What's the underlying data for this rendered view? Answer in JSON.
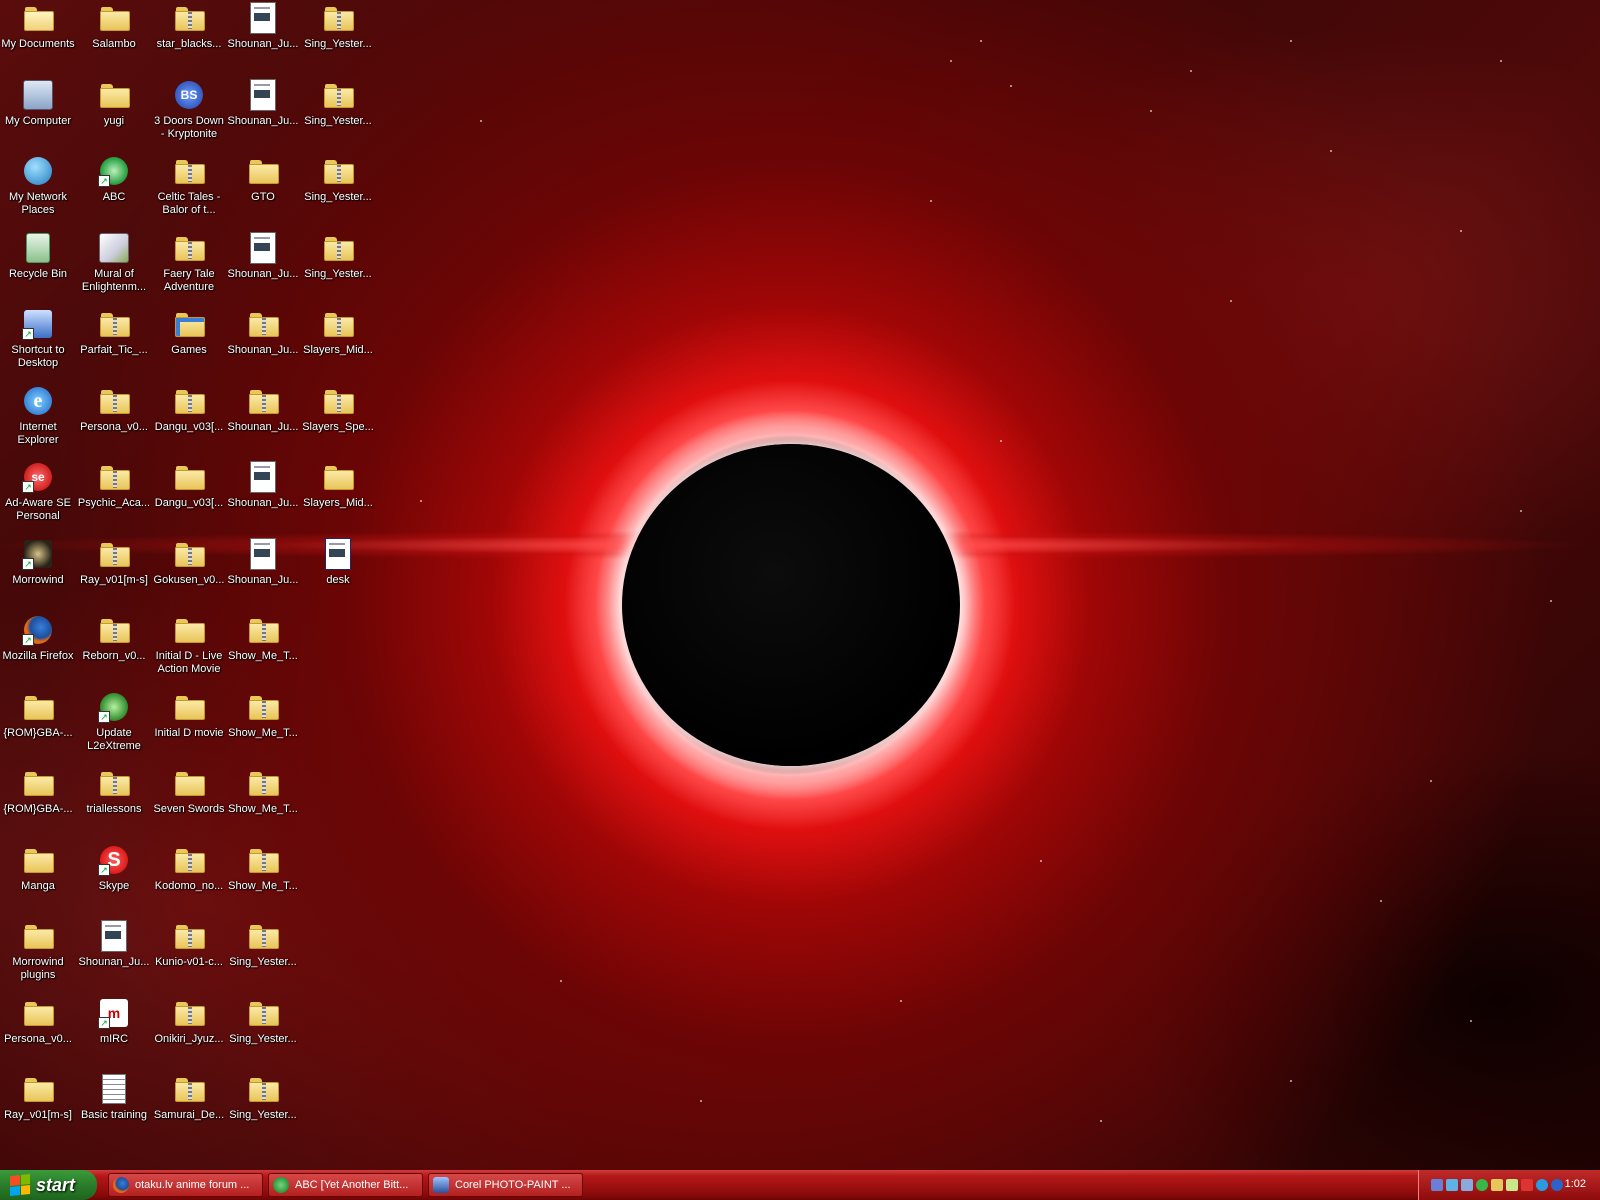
{
  "desktop": {
    "icons": [
      {
        "label": "My Documents",
        "kind": "mydocs"
      },
      {
        "label": "My Computer",
        "kind": "mycomputer"
      },
      {
        "label": "My Network Places",
        "kind": "network"
      },
      {
        "label": "Recycle Bin",
        "kind": "recycle"
      },
      {
        "label": "Shortcut to Desktop",
        "kind": "desktopshortcut"
      },
      {
        "label": "Internet Explorer",
        "kind": "ie"
      },
      {
        "label": "Ad-Aware SE Personal",
        "kind": "adaware"
      },
      {
        "label": "Morrowind",
        "kind": "morrowind"
      },
      {
        "label": "Mozilla Firefox",
        "kind": "firefox"
      },
      {
        "label": "{ROM}GBA-...",
        "kind": "folder"
      },
      {
        "label": "{ROM}GBA-...",
        "kind": "folder"
      },
      {
        "label": "Manga",
        "kind": "folder"
      },
      {
        "label": "Morrowind plugins",
        "kind": "folder"
      },
      {
        "label": "Persona_v0...",
        "kind": "folder"
      },
      {
        "label": "Ray_v01[m-s]",
        "kind": "folder"
      },
      {
        "label": "Salambo",
        "kind": "folder"
      },
      {
        "label": "yugi",
        "kind": "folder"
      },
      {
        "label": "ABC",
        "kind": "abc"
      },
      {
        "label": "Mural of Enlightenm...",
        "kind": "mural"
      },
      {
        "label": "Parfait_Tic_...",
        "kind": "zip"
      },
      {
        "label": "Persona_v0...",
        "kind": "zip"
      },
      {
        "label": "Psychic_Aca...",
        "kind": "zip"
      },
      {
        "label": "Ray_v01[m-s]",
        "kind": "zip"
      },
      {
        "label": "Reborn_v0...",
        "kind": "zip"
      },
      {
        "label": "Update L2eXtreme",
        "kind": "update"
      },
      {
        "label": "triallessons",
        "kind": "zip"
      },
      {
        "label": "Skype",
        "kind": "skype"
      },
      {
        "label": "Shounan_Ju...",
        "kind": "doc"
      },
      {
        "label": "mIRC",
        "kind": "mirc"
      },
      {
        "label": "Basic training",
        "kind": "note"
      },
      {
        "label": "star_blacks...",
        "kind": "zip"
      },
      {
        "label": "3 Doors Down - Kryptonite",
        "kind": "bs"
      },
      {
        "label": "Celtic Tales - Balor of t...",
        "kind": "zip"
      },
      {
        "label": "Faery Tale Adventure",
        "kind": "zip"
      },
      {
        "label": "Games",
        "kind": "games"
      },
      {
        "label": "Dangu_v03[...",
        "kind": "zip"
      },
      {
        "label": "Dangu_v03[...",
        "kind": "folder"
      },
      {
        "label": "Gokusen_v0...",
        "kind": "zip"
      },
      {
        "label": "Initial D - Live Action Movie",
        "kind": "folder"
      },
      {
        "label": "Initial D movie",
        "kind": "folder"
      },
      {
        "label": "Seven Swords",
        "kind": "folder"
      },
      {
        "label": "Kodomo_no...",
        "kind": "zip"
      },
      {
        "label": "Kunio-v01-c...",
        "kind": "zip"
      },
      {
        "label": "Onikiri_Jyuz...",
        "kind": "zip"
      },
      {
        "label": "Samurai_De...",
        "kind": "zip"
      },
      {
        "label": "Shounan_Ju...",
        "kind": "doc"
      },
      {
        "label": "Shounan_Ju...",
        "kind": "doc"
      },
      {
        "label": "GTO",
        "kind": "folder"
      },
      {
        "label": "Shounan_Ju...",
        "kind": "doc"
      },
      {
        "label": "Shounan_Ju...",
        "kind": "zip"
      },
      {
        "label": "Shounan_Ju...",
        "kind": "zip"
      },
      {
        "label": "Shounan_Ju...",
        "kind": "doc"
      },
      {
        "label": "Shounan_Ju...",
        "kind": "doc"
      },
      {
        "label": "Show_Me_T...",
        "kind": "zip"
      },
      {
        "label": "Show_Me_T...",
        "kind": "zip"
      },
      {
        "label": "Show_Me_T...",
        "kind": "zip"
      },
      {
        "label": "Show_Me_T...",
        "kind": "zip"
      },
      {
        "label": "Sing_Yester...",
        "kind": "zip"
      },
      {
        "label": "Sing_Yester...",
        "kind": "zip"
      },
      {
        "label": "Sing_Yester...",
        "kind": "zip"
      },
      {
        "label": "Sing_Yester...",
        "kind": "zip"
      },
      {
        "label": "Sing_Yester...",
        "kind": "zip"
      },
      {
        "label": "Sing_Yester...",
        "kind": "zip"
      },
      {
        "label": "Sing_Yester...",
        "kind": "zip"
      },
      {
        "label": "Slayers_Mid...",
        "kind": "zip"
      },
      {
        "label": "Slayers_Spe...",
        "kind": "zip"
      },
      {
        "label": "Slayers_Mid...",
        "kind": "folder"
      },
      {
        "label": "desk",
        "kind": "desk"
      }
    ]
  },
  "taskbar": {
    "start_label": "start",
    "tasks": [
      {
        "label": "otaku.lv anime forum ...",
        "icon": "firefox"
      },
      {
        "label": "ABC [Yet Another Bitt...",
        "icon": "abc"
      },
      {
        "label": "Corel PHOTO-PAINT ...",
        "icon": "corel"
      }
    ],
    "clock": "1:02"
  },
  "colors": {
    "taskbar_red": "#b41818",
    "start_green": "#2b7d2b"
  }
}
